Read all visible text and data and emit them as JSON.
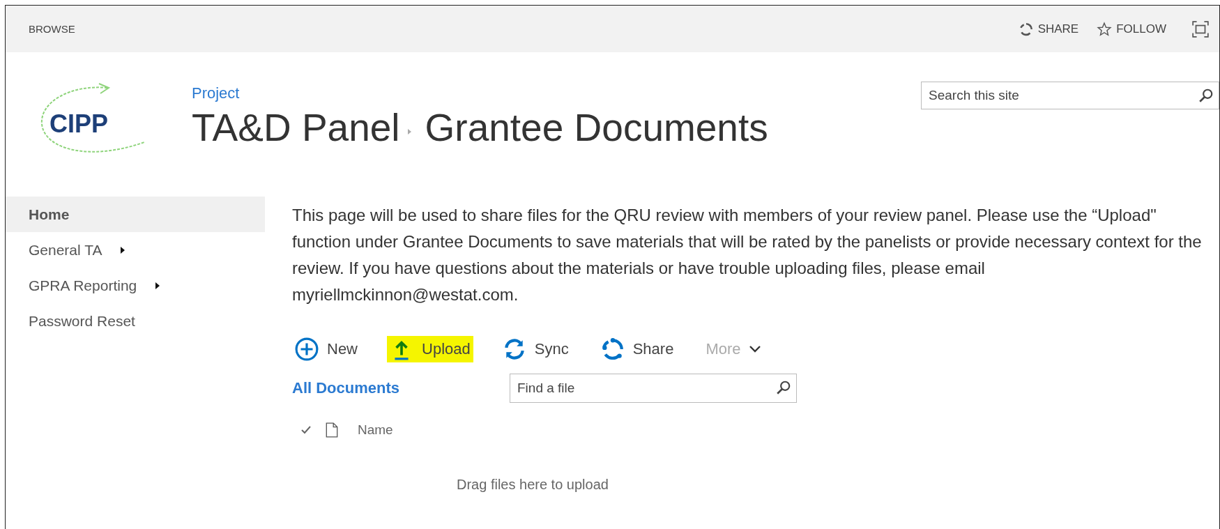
{
  "top_bar": {
    "browse": "BROWSE",
    "actions": [
      {
        "kind": "share",
        "label": "SHARE"
      },
      {
        "kind": "follow",
        "label": "FOLLOW"
      }
    ]
  },
  "logo": {
    "text": "CIPP"
  },
  "breadcrumb": {
    "parent": "Project",
    "site": "TA&D Panel",
    "page": "Grantee Documents"
  },
  "search": {
    "placeholder": "Search this site"
  },
  "sidebar": {
    "items": [
      {
        "label": "Home",
        "selected": true,
        "has_submenu": false
      },
      {
        "label": "General TA",
        "selected": false,
        "has_submenu": true
      },
      {
        "label": "GPRA Reporting",
        "selected": false,
        "has_submenu": true
      },
      {
        "label": "Password Reset",
        "selected": false,
        "has_submenu": false
      }
    ]
  },
  "intro": "This page will be used to share files for the QRU review with members of your review panel. Please use the “Upload\" function under Grantee Documents to save materials that will be rated by the panelists or provide necessary context for the review. If you have questions about the materials or have trouble uploading files, please email myriellmckinnon@westat.com.",
  "toolbar": [
    {
      "kind": "new",
      "label": "New",
      "highlighted": false,
      "disabled": false
    },
    {
      "kind": "upload",
      "label": "Upload",
      "highlighted": true,
      "disabled": false
    },
    {
      "kind": "sync",
      "label": "Sync",
      "highlighted": false,
      "disabled": false
    },
    {
      "kind": "share",
      "label": "Share",
      "highlighted": false,
      "disabled": false
    },
    {
      "kind": "more",
      "label": "More",
      "highlighted": false,
      "disabled": true
    }
  ],
  "view": {
    "label": "All Documents"
  },
  "find": {
    "placeholder": "Find a file"
  },
  "columns": [
    {
      "label": "Name"
    }
  ],
  "empty_message": "Drag files here to upload"
}
